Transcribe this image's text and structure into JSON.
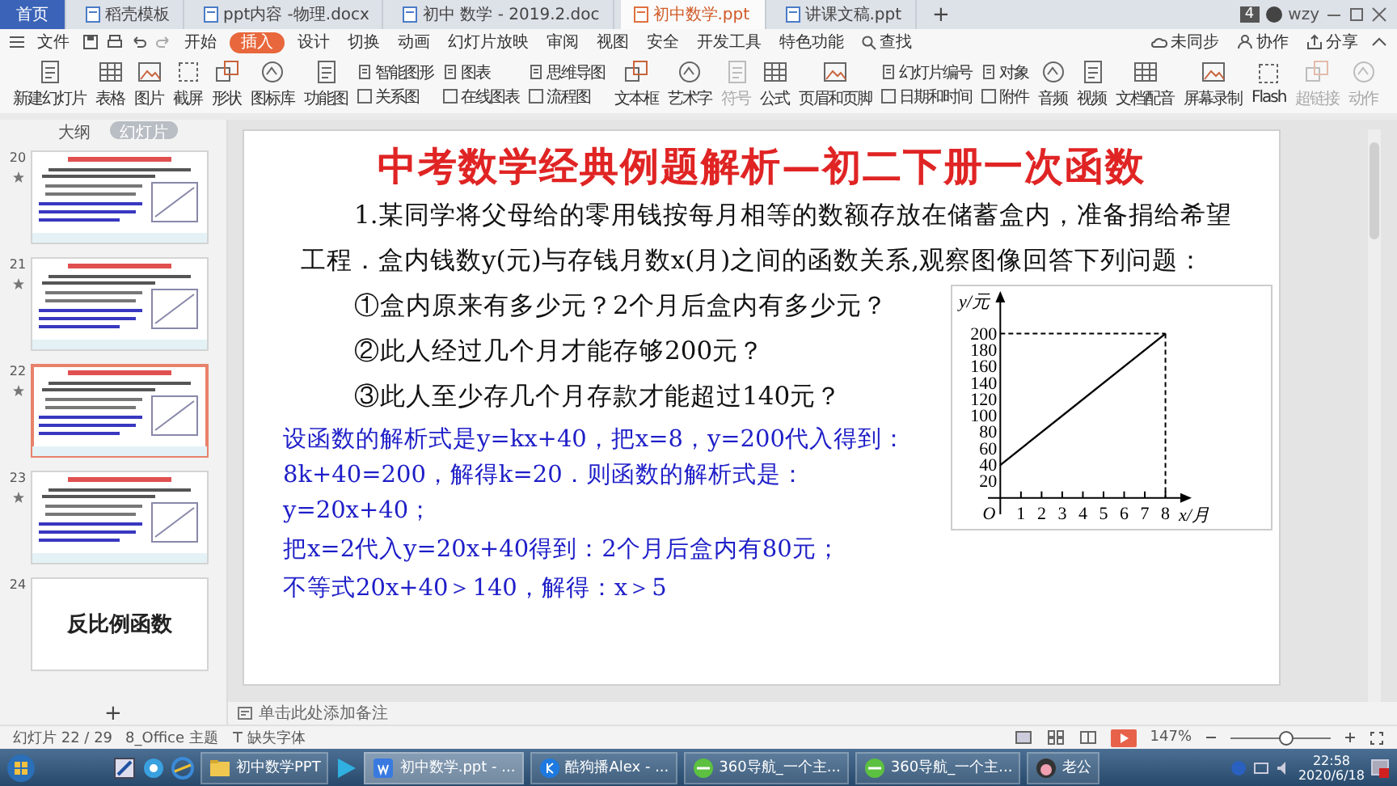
{
  "tabs": [
    {
      "label": "首页",
      "selected": false,
      "kind": "home"
    },
    {
      "label": "稻壳模板",
      "selected": false,
      "kind": "doc"
    },
    {
      "label": "ppt内容 -物理.docx",
      "selected": false,
      "kind": "doc"
    },
    {
      "label": "初中 数学 - 2019.2.doc",
      "selected": false,
      "kind": "doc"
    },
    {
      "label": "初中数学.ppt",
      "selected": true,
      "kind": "doc"
    },
    {
      "label": "讲课文稿.ppt",
      "selected": false,
      "kind": "doc"
    }
  ],
  "new_tab": "+",
  "window_count": "4",
  "user": "wzy",
  "menu": {
    "file": "文件",
    "items": [
      {
        "label": "开始",
        "selected": false
      },
      {
        "label": "插入",
        "selected": true
      },
      {
        "label": "设计",
        "selected": false
      },
      {
        "label": "切换",
        "selected": false
      },
      {
        "label": "动画",
        "selected": false
      },
      {
        "label": "幻灯片放映",
        "selected": false
      },
      {
        "label": "审阅",
        "selected": false
      },
      {
        "label": "视图",
        "selected": false
      },
      {
        "label": "安全",
        "selected": false
      },
      {
        "label": "开发工具",
        "selected": false
      },
      {
        "label": "特色功能",
        "selected": false
      }
    ],
    "search": "查找",
    "right": [
      "未同步",
      "协作",
      "分享"
    ]
  },
  "ribbon": [
    {
      "kind": "large",
      "label": "新建幻灯片",
      "disabled": false
    },
    {
      "kind": "large",
      "label": "表格",
      "disabled": false
    },
    {
      "kind": "large",
      "label": "图片",
      "disabled": false
    },
    {
      "kind": "large",
      "label": "截屏",
      "disabled": false
    },
    {
      "kind": "large",
      "label": "形状",
      "disabled": false
    },
    {
      "kind": "large",
      "label": "图标库",
      "disabled": false
    },
    {
      "kind": "large",
      "label": "功能图",
      "disabled": false
    },
    {
      "kind": "stack",
      "items": [
        {
          "label": "智能图形"
        },
        {
          "label": "关系图"
        }
      ],
      "disabled": false
    },
    {
      "kind": "stack",
      "items": [
        {
          "label": "图表"
        },
        {
          "label": "在线图表"
        }
      ],
      "disabled": false
    },
    {
      "kind": "stack",
      "items": [
        {
          "label": "思维导图"
        },
        {
          "label": "流程图"
        }
      ],
      "disabled": false
    },
    {
      "kind": "large",
      "label": "文本框",
      "disabled": false
    },
    {
      "kind": "large",
      "label": "艺术字",
      "disabled": false
    },
    {
      "kind": "large",
      "label": "符号",
      "disabled": true
    },
    {
      "kind": "large",
      "label": "公式",
      "disabled": false
    },
    {
      "kind": "large",
      "label": "页眉和页脚",
      "disabled": false
    },
    {
      "kind": "stack",
      "items": [
        {
          "label": "幻灯片编号"
        },
        {
          "label": "日期和时间"
        }
      ],
      "disabled": false
    },
    {
      "kind": "stack",
      "items": [
        {
          "label": "对象"
        },
        {
          "label": "附件"
        }
      ],
      "disabled": false
    },
    {
      "kind": "large",
      "label": "音频",
      "disabled": false
    },
    {
      "kind": "large",
      "label": "视频",
      "disabled": false
    },
    {
      "kind": "large",
      "label": "文档配音",
      "disabled": false
    },
    {
      "kind": "large",
      "label": "屏幕录制",
      "disabled": false
    },
    {
      "kind": "large",
      "label": "Flash",
      "disabled": false
    },
    {
      "kind": "large",
      "label": "超链接",
      "disabled": true
    },
    {
      "kind": "large",
      "label": "动作",
      "disabled": true
    }
  ],
  "panel": {
    "tabs": [
      {
        "label": "大纲",
        "selected": false
      },
      {
        "label": "幻灯片",
        "selected": true
      }
    ],
    "slides": [
      {
        "number": "20",
        "kind": "content",
        "selected": false,
        "animated": true
      },
      {
        "number": "21",
        "kind": "content",
        "selected": false,
        "animated": true
      },
      {
        "number": "22",
        "kind": "content",
        "selected": true,
        "animated": true
      },
      {
        "number": "23",
        "kind": "content",
        "selected": false,
        "animated": true
      },
      {
        "number": "24",
        "kind": "title",
        "title": "反比例函数",
        "selected": false,
        "animated": false
      }
    ],
    "add": "+"
  },
  "slide": {
    "title": "中考数学经典例题解析—初二下册一次函数",
    "problem": "1.某同学将父母给的零用钱按每月相等的数额存放在储蓄盒内，准备捐给希望工程．盒内钱数y(元)与存钱月数x(月)之间的函数关系,观察图像回答下列问题：",
    "questions": [
      "①盒内原来有多少元？2个月后盒内有多少元？",
      "②此人经过几个月才能存够200元？",
      "③此人至少存几个月存款才能超过140元？"
    ],
    "answers": [
      "设函数的解析式是y=kx+40，把x=8，y=200代入得到：8k+40=200，解得k=20．则函数的解析式是：y=20x+40；",
      "把x=2代入y=20x+40得到：2个月后盒内有80元；",
      "不等式20x+40＞140，解得：x＞5"
    ],
    "chart_data": {
      "type": "line",
      "xlabel": "x/月",
      "ylabel": "y/元",
      "x": [
        0,
        8
      ],
      "series": [
        {
          "color": "#000000",
          "values": [
            40,
            200
          ]
        }
      ],
      "xlim": [
        -0.6,
        8.8
      ],
      "ylim": [
        -20,
        240
      ],
      "annotations": [
        "O"
      ],
      "xticks": [
        1,
        2,
        3,
        4,
        5,
        6,
        7,
        8
      ],
      "yticks": [
        20,
        40,
        60,
        80,
        100,
        120,
        140,
        160,
        180,
        200
      ]
    }
  },
  "notes": "单击此处添加备注",
  "status": {
    "slide": "幻灯片 22 / 29",
    "theme": "8_Office 主题",
    "fonts": "缺失字体",
    "zoom": {
      "reading": "147%",
      "level": 0.55
    }
  },
  "taskbar": {
    "items": [
      {
        "label": "初中数学PPT",
        "kind": "folder",
        "selected": false
      },
      {
        "label": "初中数学.ppt - ...",
        "kind": "wps",
        "selected": true
      },
      {
        "label": "酷狗播Alex - ...",
        "kind": "music",
        "selected": false
      },
      {
        "label": "360导航_一个主...",
        "kind": "browser",
        "selected": false
      },
      {
        "label": "360导航_一个主...",
        "kind": "browser",
        "selected": false
      },
      {
        "label": "老公",
        "kind": "chat",
        "selected": false
      }
    ],
    "time": "22:58",
    "date": "2020/6/18"
  }
}
